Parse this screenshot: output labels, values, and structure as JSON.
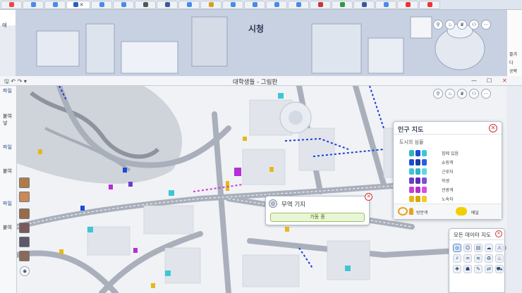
{
  "bg_window": {
    "title": "시청"
  },
  "paint_window": {
    "title": "대학생들 - 그림판"
  },
  "left_strip": {
    "labels": [
      "파일",
      "붙여넣",
      "파일",
      "붙여",
      "파일",
      "붙여"
    ]
  },
  "right_strip": {
    "labels": [
      "즐겨",
      "다",
      "공략"
    ]
  },
  "bookmark_bar": {
    "apps_label": "애"
  },
  "population_panel": {
    "title": "인구 지도",
    "subtitle": "도시의 심들",
    "rows": [
      {
        "label": "집에 있음",
        "color": "#2db7c4"
      },
      {
        "label": "쇼핑객",
        "color": "#1a4dd6"
      },
      {
        "label": "근로자",
        "color": "#3fc6d6"
      },
      {
        "label": "학생",
        "color": "#6a3fc7"
      },
      {
        "label": "관광객",
        "color": "#c43fd6"
      },
      {
        "label": "노숙자",
        "color": "#e6b81a"
      }
    ],
    "footer_left": "방문객",
    "footer_right": "배달"
  },
  "trade_popup": {
    "name": "무역 기지",
    "button": "가동 중"
  },
  "all_data_maps": {
    "title": "모든 데이터 지도"
  },
  "colors": {
    "map_bg": "#f0f2f5",
    "road": "#9aa2ae",
    "panel_border": "#b7c1d0"
  }
}
